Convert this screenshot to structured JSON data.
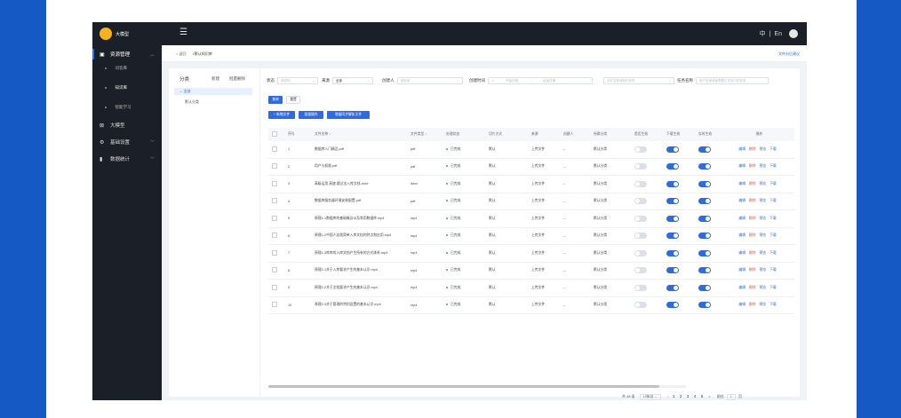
{
  "header": {
    "logo_text": "大模型",
    "lang_zh": "中",
    "lang_sep": "|",
    "lang_en": "En",
    "menu_icon": "hamburger-icon"
  },
  "sidebar": {
    "groups": [
      {
        "label": "资源管理",
        "icon": "book-icon",
        "expanded": true
      },
      {
        "label": "大模型",
        "icon": "cube-icon"
      },
      {
        "label": "基础设置",
        "icon": "gear-icon"
      },
      {
        "label": "数据统计",
        "icon": "bar-chart-icon"
      }
    ],
    "subitems": [
      "问答库",
      "知识库",
      "智能学习"
    ]
  },
  "breadcrumb": {
    "back": "< 返回",
    "current": "I 默认知识库",
    "right_link": "文件向后建议"
  },
  "category": {
    "title": "分类",
    "action_add": "新建",
    "action_batch": "批量删除",
    "all": "全部",
    "default": "默认分类"
  },
  "filters": {
    "status_label": "状态",
    "status_placeholder": "请选择",
    "source_label": "来源",
    "source_value": "全部",
    "creator_label": "创建人",
    "creator_placeholder": "请选择",
    "time_label": "创建时间",
    "start_placeholder": "开始日期",
    "end_placeholder": "结束日期",
    "search_placeholder": "文件名称或知识标签",
    "task_label": "任务名称",
    "task_placeholder": "用户查询或者需要正在执行的任务"
  },
  "buttons": {
    "search": "查询",
    "reset": "重置",
    "add_file": "+ 新增文件",
    "batch_ops": "批量操作",
    "sync": "增量同步解析文件"
  },
  "table": {
    "columns": [
      "序号",
      "文件名称 ↕",
      "文件类型 ↕",
      "处理状态",
      "切片方式",
      "来源",
      "创建人",
      "所属分类",
      "是否生效",
      "下载生效",
      "实时生效",
      "操作"
    ],
    "ops": [
      "编辑",
      "删除",
      "预览",
      "下载"
    ],
    "rows": [
      {
        "idx": "1",
        "name": "数据库入门精品.pdf",
        "type": "pdf",
        "status": "已完成",
        "split": "默认",
        "source": "上传文件",
        "creator": "--",
        "category": "默认分类",
        "t1": false,
        "t2": true,
        "t3": true
      },
      {
        "idx": "2",
        "name": "用户与权限.pdf",
        "type": "pdf",
        "status": "已完成",
        "split": "默认",
        "source": "上传文件",
        "creator": "--",
        "category": "默认分类",
        "t1": false,
        "t2": true,
        "t3": true
      },
      {
        "idx": "3",
        "name": "高级运用 高速 跳过出入库文档.docx",
        "type": "docx",
        "status": "已完成",
        "split": "默认",
        "source": "上传文件",
        "creator": "--",
        "category": "默认分类",
        "t1": false,
        "t2": true,
        "t3": true
      },
      {
        "idx": "4",
        "name": "数据库服务器环境安装配置.pdf",
        "type": "pdf",
        "status": "已完成",
        "split": "默认",
        "source": "上传文件",
        "creator": "--",
        "category": "默认分类",
        "t1": false,
        "t2": true,
        "t3": true
      },
      {
        "idx": "5",
        "name": "原理1-1数据库的基础概念以及常用数据库.mp4",
        "type": "mp4",
        "status": "已完成",
        "split": "默认",
        "source": "上传文件",
        "creator": "--",
        "category": "默认分类",
        "t1": false,
        "t2": true,
        "t3": true
      },
      {
        "idx": "6",
        "name": "原理1-2中国人自我简单入库文档的特点和应用.mp4",
        "type": "mp4",
        "status": "已完成",
        "split": "默认",
        "source": "上传文件",
        "creator": "--",
        "category": "默认分类",
        "t1": false,
        "t2": true,
        "t3": true
      },
      {
        "idx": "7",
        "name": "原理1-3库库的入库文档产生所有的方式体系.mp4",
        "type": "mp4",
        "status": "已完成",
        "split": "默认",
        "source": "上传文件",
        "creator": "--",
        "category": "默认分类",
        "t1": false,
        "t2": true,
        "t3": true
      },
      {
        "idx": "8",
        "name": "原理2-1关于入库要求产生的基本认识.mp4",
        "type": "mp4",
        "status": "已完成",
        "split": "默认",
        "source": "上传文件",
        "creator": "--",
        "category": "默认分类",
        "t1": false,
        "t2": true,
        "t3": true
      },
      {
        "idx": "9",
        "name": "原理2-2关于文档要求产生的基本认识.mp4",
        "type": "mp4",
        "status": "已完成",
        "split": "默认",
        "source": "上传文件",
        "creator": "--",
        "category": "默认分类",
        "t1": false,
        "t2": true,
        "t3": true
      },
      {
        "idx": "10",
        "name": "原理2-3关于管理的特别设置的基本认识.mp4",
        "type": "mp4",
        "status": "已完成",
        "split": "默认",
        "source": "上传文件",
        "creator": "--",
        "category": "默认分类",
        "t1": false,
        "t2": true,
        "t3": true
      }
    ]
  },
  "pager": {
    "total": "共 48 条",
    "size": "10条/页",
    "prev": "<",
    "pages": [
      "1",
      "2",
      "3",
      "4",
      "5"
    ],
    "current": "1",
    "next": ">",
    "goto_label": "前往",
    "goto_value": "1",
    "goto_suffix": "页"
  }
}
